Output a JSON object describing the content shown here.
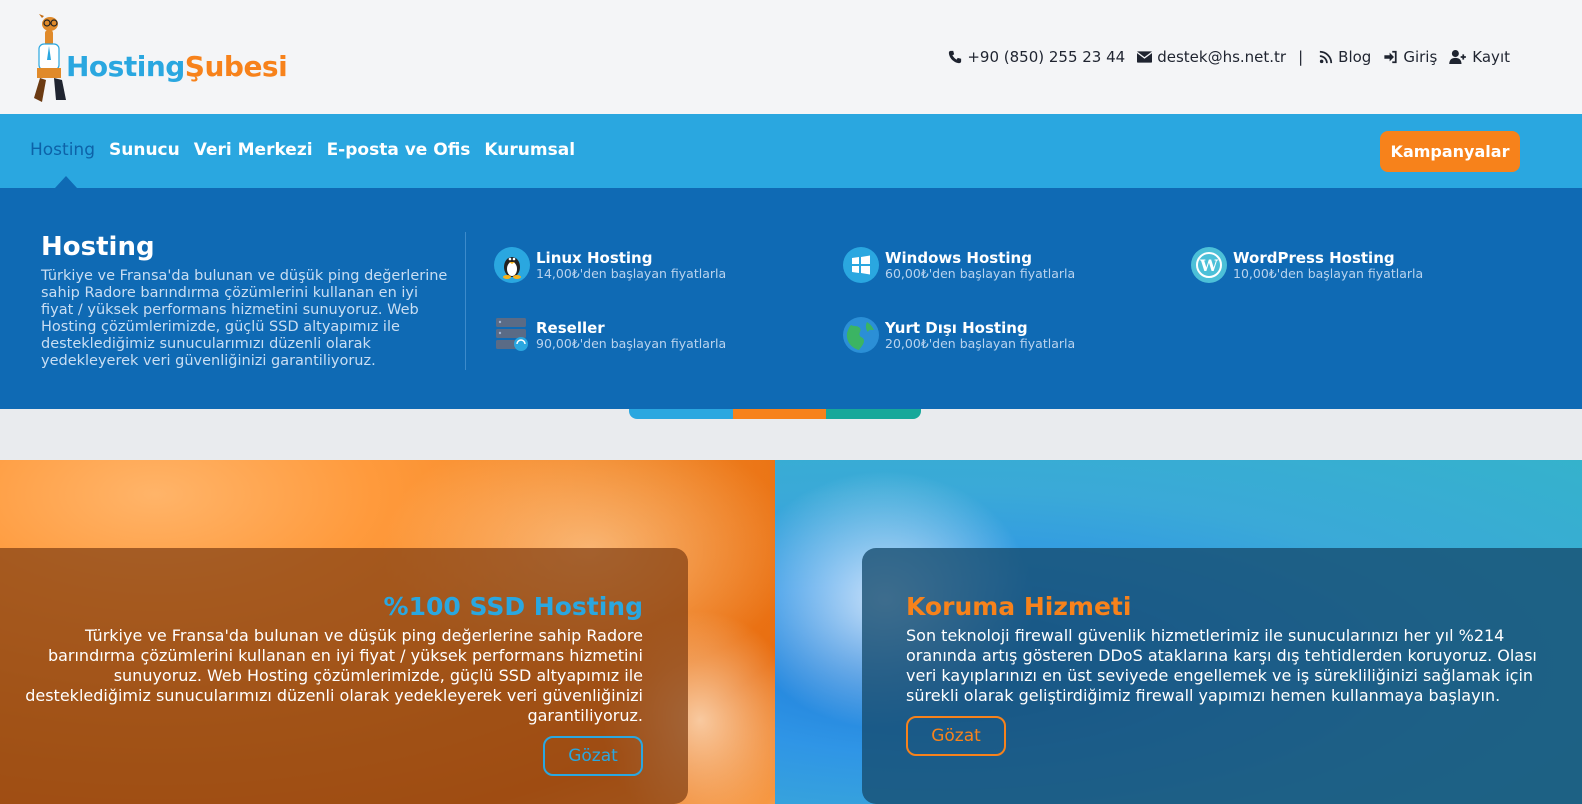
{
  "brand": {
    "logo_part1": "Hosting",
    "logo_part2": "Şubesi",
    "primary_color": "#2aa7e0",
    "accent_color": "#f7821b",
    "dark_blue": "#0f6ab4"
  },
  "contact": {
    "phone": "+90 (850) 255 23 44",
    "email": "destek@hs.net.tr",
    "separator": "|",
    "blog": "Blog",
    "login": "Giriş",
    "register": "Kayıt"
  },
  "nav": {
    "items": [
      "Hosting",
      "Sunucu",
      "Veri Merkezi",
      "E-posta ve Ofis",
      "Kurumsal"
    ],
    "active": "Hosting",
    "campaign_button": "Kampanyalar"
  },
  "mega": {
    "title": "Hosting",
    "description": "Türkiye ve Fransa'da bulunan ve düşük ping değerlerine sahip Radore barındırma çözümlerini kullanan en iyi fiyat / yüksek performans hizmetini sunuyoruz. Web Hosting çözümlerimizde, güçlü SSD altyapımız ile desteklediğimiz sunucularımızı düzenli olarak yedekleyerek veri güvenliğinizi garantiliyoruz.",
    "items": [
      {
        "name": "Linux Hosting",
        "price": "14,00₺'den başlayan fiyatlarla",
        "icon": "linux-icon"
      },
      {
        "name": "Windows Hosting",
        "price": "60,00₺'den başlayan fiyatlarla",
        "icon": "windows-icon"
      },
      {
        "name": "WordPress Hosting",
        "price": "10,00₺'den başlayan fiyatlarla",
        "icon": "wordpress-icon"
      },
      {
        "name": "Reseller",
        "price": "90,00₺'den başlayan fiyatlarla",
        "icon": "server-icon"
      },
      {
        "name": "Yurt Dışı Hosting",
        "price": "20,00₺'den başlayan fiyatlarla",
        "icon": "globe-icon"
      }
    ]
  },
  "promo": {
    "left": {
      "title": "%100 SSD Hosting",
      "text": "Türkiye ve Fransa'da bulunan ve düşük ping değerlerine sahip Radore barındırma çözümlerini kullanan en iyi fiyat / yüksek performans hizmetini sunuyoruz. Web Hosting çözümlerimizde, güçlü SSD altyapımız ile desteklediğimiz sunucularımızı düzenli olarak yedekleyerek veri güvenliğinizi garantiliyoruz.",
      "button": "Gözat",
      "title_color": "#2aa7e0"
    },
    "right": {
      "title": "Koruma Hizmeti",
      "text": "Son teknoloji firewall güvenlik hizmetlerimiz ile sunucularınızı her yıl %214 oranında artış gösteren DDoS ataklarına karşı dış tehtidlerden koruyoruz. Olası veri kayıplarınızı en üst seviyede engellemek ve iş sürekliliğinizi sağlamak için sürekli olarak geliştirdiğimiz firewall yapımızı hemen kullanmaya başlayın.",
      "button": "Gözat",
      "title_color": "#f7821b"
    }
  }
}
